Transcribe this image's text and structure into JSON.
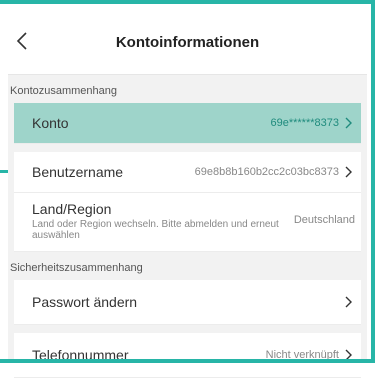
{
  "header": {
    "title": "Kontoinformationen"
  },
  "sections": {
    "account_context": "Kontozusammenhang",
    "security_context": "Sicherheitszusammenhang"
  },
  "rows": {
    "konto": {
      "label": "Konto",
      "value": "69e******8373"
    },
    "benutzername": {
      "label": "Benutzername",
      "value": "69e8b8b160b2cc2c03bc8373"
    },
    "region": {
      "label": "Land/Region",
      "sub": "Land oder Region wechseln. Bitte abmelden und erneut auswählen",
      "value": "Deutschland"
    },
    "passwort": {
      "label": "Passwort ändern"
    },
    "telefon": {
      "label": "Telefonnummer",
      "value": "Nicht verknüpft"
    }
  },
  "icons": {
    "back": "chevron-left-icon",
    "row_arrow": "chevron-right-icon"
  },
  "colors": {
    "accent": "#27b5a7",
    "highlight": "#9ed4ca"
  }
}
